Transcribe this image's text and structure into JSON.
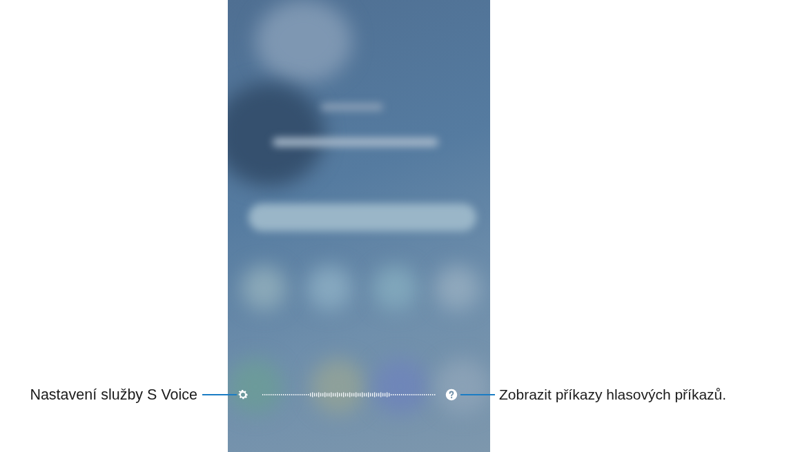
{
  "callouts": [
    {
      "text": "Nastavení služby S Voice"
    },
    {
      "text": "Zobrazit příkazy hlasových příkazů."
    }
  ]
}
